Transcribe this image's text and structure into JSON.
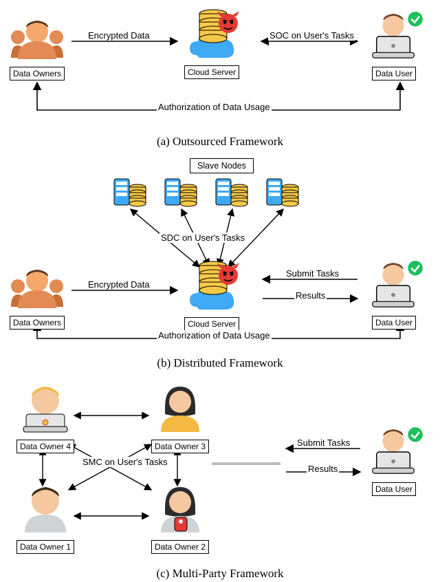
{
  "sectionA": {
    "caption": "(a) Outsourced Framework",
    "entities": {
      "data_owners": "Data Owners",
      "cloud_server": "Cloud Server",
      "data_user": "Data User"
    },
    "edges": {
      "encrypted_data": "Encrypted Data",
      "soc": "SOC on User's Tasks",
      "authorization": "Authorization of Data Usage"
    }
  },
  "sectionB": {
    "caption": "(b) Distributed Framework",
    "slave_label": "Slave Nodes",
    "entities": {
      "data_owners": "Data Owners",
      "cloud_server": "Cloud Server",
      "data_user": "Data User"
    },
    "edges": {
      "encrypted_data": "Encrypted Data",
      "sdc": "SDC on User's Tasks",
      "submit_tasks": "Submit Tasks",
      "results": "Results",
      "authorization": "Authorization of Data Usage"
    }
  },
  "sectionC": {
    "caption": "(c) Multi-Party Framework",
    "entities": {
      "owner1": "Data Owner 1",
      "owner2": "Data Owner 2",
      "owner3": "Data Owner 3",
      "owner4": "Data Owner 4",
      "data_user": "Data User"
    },
    "edges": {
      "smc": "SMC on User's Tasks",
      "submit_tasks": "Submit Tasks",
      "results": "Results"
    }
  }
}
